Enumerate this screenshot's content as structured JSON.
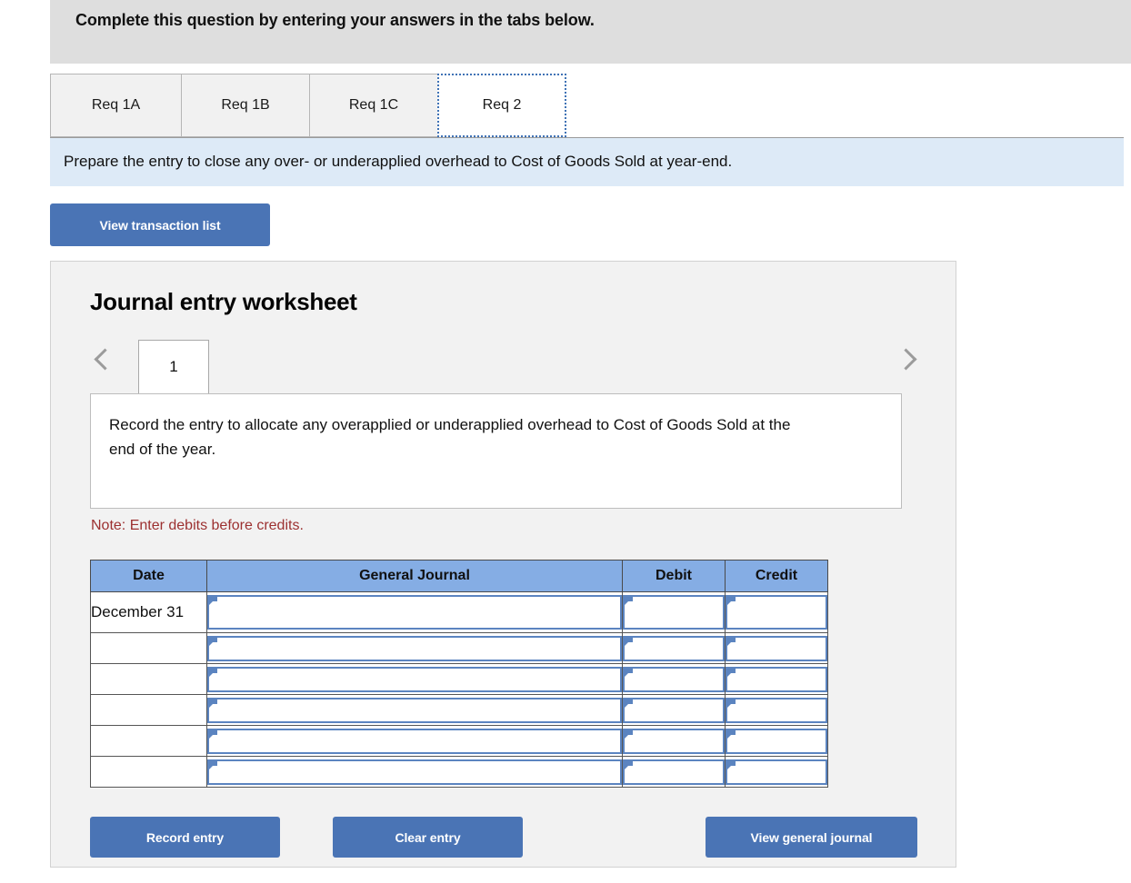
{
  "banner": {
    "text": "Complete this question by entering your answers in the tabs below."
  },
  "tabs": [
    {
      "label": "Req 1A",
      "active": false
    },
    {
      "label": "Req 1B",
      "active": false
    },
    {
      "label": "Req 1C",
      "active": false
    },
    {
      "label": "Req 2",
      "active": true
    }
  ],
  "instruction": {
    "text": "Prepare the entry to close any over- or underapplied overhead to Cost of Goods Sold at year-end."
  },
  "toolbar": {
    "view_transaction_list_label": "View transaction list"
  },
  "worksheet": {
    "title": "Journal entry worksheet",
    "pager": {
      "prev_icon": "chevron-left-icon",
      "next_icon": "chevron-right-icon",
      "current_page": "1"
    },
    "description": "Record the entry to allocate any overapplied or underapplied overhead to Cost of Goods Sold at the end of the year.",
    "note": "Note: Enter debits before credits.",
    "table": {
      "headers": [
        "Date",
        "General Journal",
        "Debit",
        "Credit"
      ],
      "rows": [
        {
          "date": "December 31",
          "general_journal": "",
          "debit": "",
          "credit": ""
        },
        {
          "date": "",
          "general_journal": "",
          "debit": "",
          "credit": ""
        },
        {
          "date": "",
          "general_journal": "",
          "debit": "",
          "credit": ""
        },
        {
          "date": "",
          "general_journal": "",
          "debit": "",
          "credit": ""
        },
        {
          "date": "",
          "general_journal": "",
          "debit": "",
          "credit": ""
        },
        {
          "date": "",
          "general_journal": "",
          "debit": "",
          "credit": ""
        }
      ]
    },
    "actions": {
      "record_entry_label": "Record entry",
      "clear_entry_label": "Clear entry",
      "view_general_journal_label": "View general journal"
    }
  },
  "colors": {
    "banner_bg": "#dedede",
    "instruction_bg": "#ddeaf7",
    "button_blue": "#4a74b5",
    "table_header_blue": "#85ade4",
    "input_border_blue": "#5b84c0",
    "note_red": "#9c3030",
    "panel_bg": "#f2f2f2",
    "active_tab_focus": "#3f72b5"
  }
}
